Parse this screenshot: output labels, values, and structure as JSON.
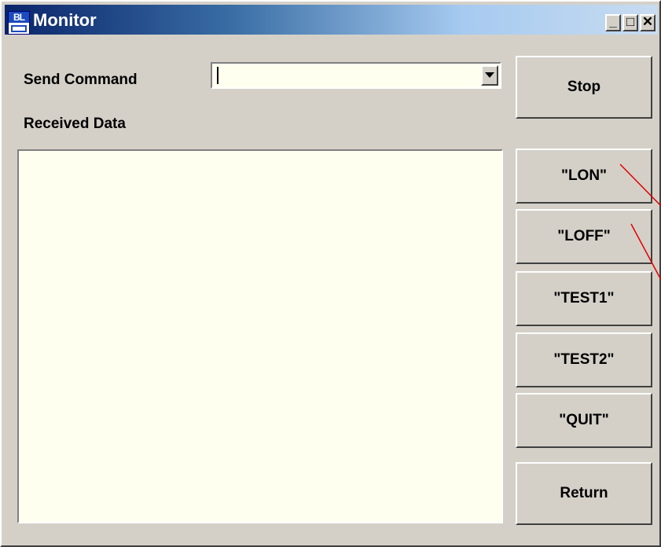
{
  "window": {
    "title": "Monitor",
    "icon_text": "BL",
    "controls": {
      "minimize": "_",
      "maximize": "□",
      "close": "✕"
    }
  },
  "send_command": {
    "label": "Send Command",
    "value": ""
  },
  "received_data": {
    "label": "Received Data",
    "content": ""
  },
  "buttons": {
    "stop": "Stop",
    "lon": "\"LON\"",
    "loff": "\"LOFF\"",
    "test1": "\"TEST1\"",
    "test2": "\"TEST2\"",
    "quit": "\"QUIT\"",
    "return": "Return"
  },
  "colors": {
    "face": "#d4d0c8",
    "field": "#fffff0",
    "title_bar": "#0a246a",
    "annotation_line": "#e00000"
  }
}
